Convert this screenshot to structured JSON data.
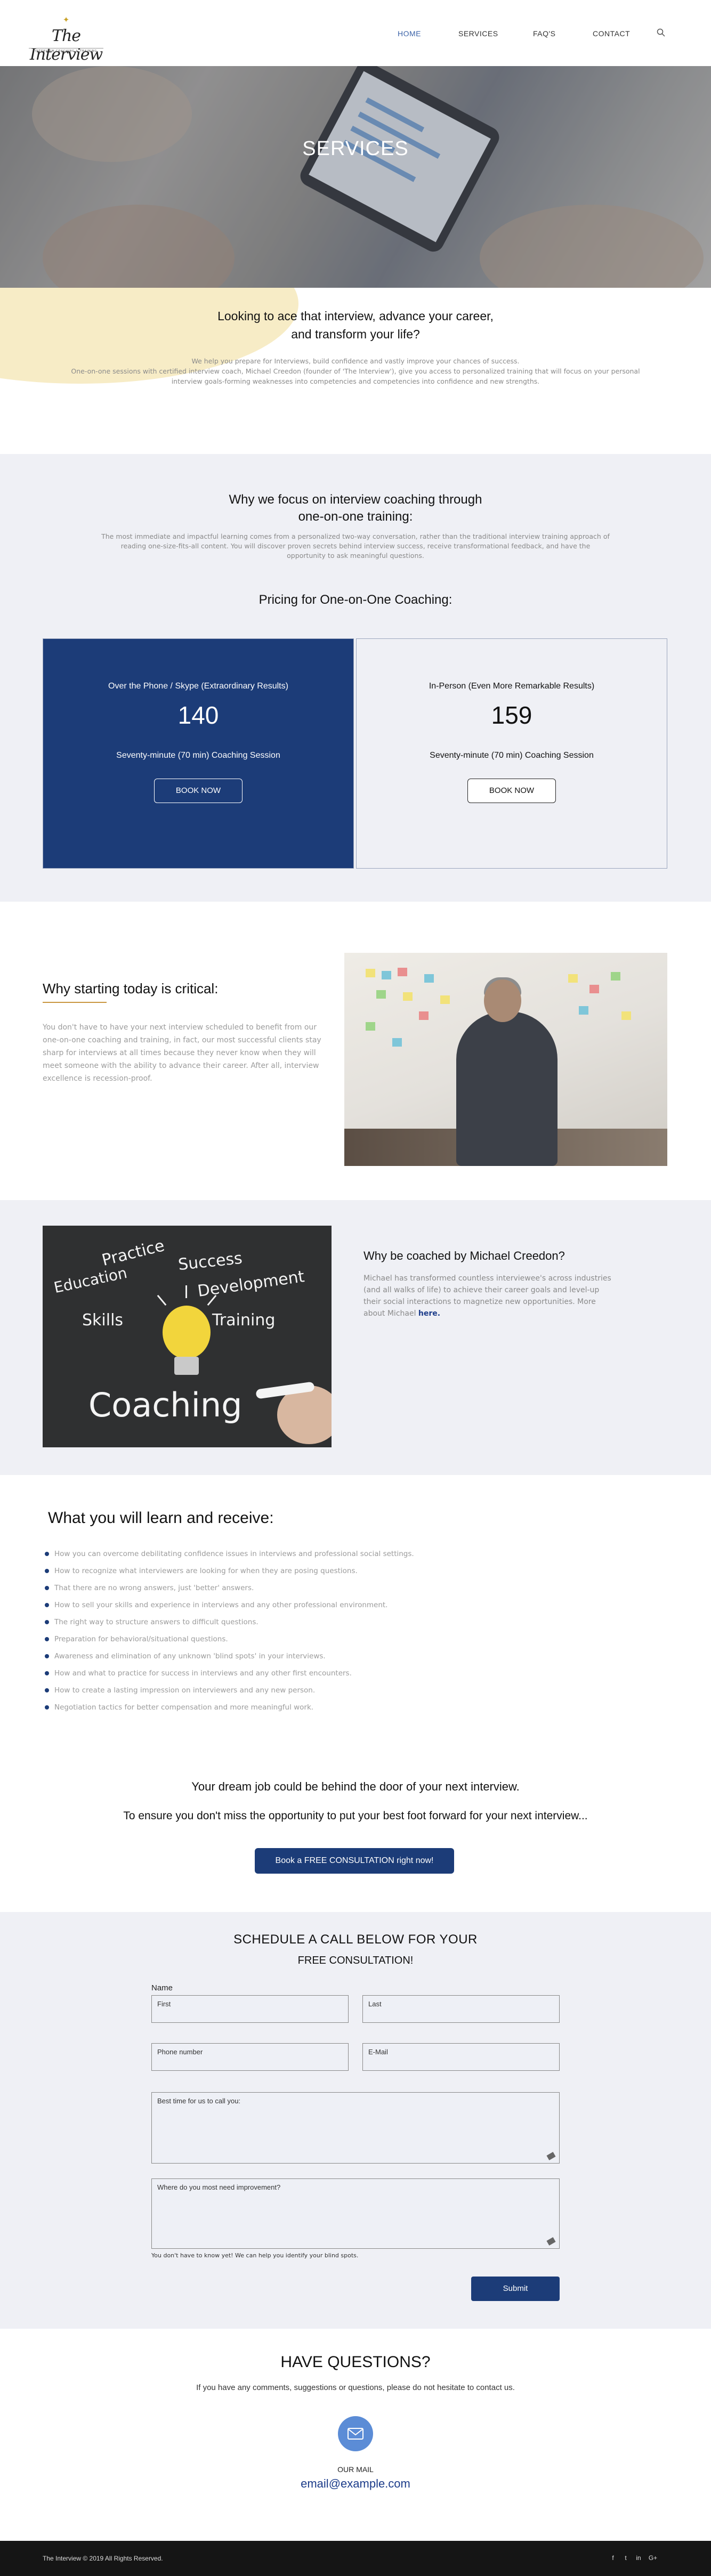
{
  "header": {
    "logo_text": "The Interview",
    "logo_tagline": "INTERVIEW COACHING & TRAINING",
    "nav": [
      {
        "label": "HOME",
        "active": true
      },
      {
        "label": "SERVICES",
        "active": false
      },
      {
        "label": "FAQ'S",
        "active": false
      },
      {
        "label": "CONTACT",
        "active": false
      }
    ],
    "search_icon": "search-icon"
  },
  "hero": {
    "title": "SERVICES"
  },
  "intro": {
    "heading_line1": "Looking to ace that interview, advance your career,",
    "heading_line2": "and transform your life?",
    "body_line1": "We help you prepare for Interviews, build confidence and vastly improve your chances of success.",
    "body_line2": "One-on-one sessions with certified interview coach, Michael Creedon (founder of 'The Interview'), give you access to personalized training that will focus on your personal interview goals-forming weaknesses into competencies and competencies into confidence and new strengths."
  },
  "focus": {
    "heading_line1": "Why we focus on interview coaching through",
    "heading_line2": "one-on-one training:",
    "body": "The most immediate and impactful learning comes from a personalized two-way conversation, rather than the traditional interview training approach of reading one-size-fits-all content. You will discover proven secrets behind interview success, receive transformational feedback, and have the opportunity to ask meaningful questions.",
    "pricing_title": "Pricing for One-on-One Coaching:",
    "cards": [
      {
        "type": "Over the Phone / Skype (Extraordinary Results)",
        "price": "140",
        "duration": "Seventy-minute (70 min) Coaching Session",
        "button": "BOOK NOW"
      },
      {
        "type": "In-Person (Even More Remarkable Results)",
        "price": "159",
        "duration": "Seventy-minute (70 min) Coaching Session",
        "button": "BOOK NOW"
      }
    ]
  },
  "critical": {
    "heading": "Why starting today is critical:",
    "body": "You don't have to have your next interview scheduled to benefit from our one-on-one coaching and training, in fact, our most successful clients stay sharp for interviews at all times because they never know when they will meet someone with the ability to advance their career. After all, interview excellence is recession-proof."
  },
  "coached": {
    "image_words": [
      "Practice",
      "Success",
      "Education",
      "Development",
      "Skills",
      "Training",
      "Coaching"
    ],
    "heading": "Why be coached by Michael Creedon?",
    "body": "Michael has transformed countless interviewee's across industries (and all walks of life) to achieve their career goals and level-up their social interactions to magnetize new opportunities. More about Michael",
    "link": "here."
  },
  "learn": {
    "heading": "What you will learn and receive:",
    "items": [
      "How you can overcome debilitating confidence issues in interviews and professional social settings.",
      "How to recognize what interviewers are looking for when they are posing questions.",
      "That there are no wrong answers, just 'better' answers.",
      "How to sell your skills and experience in interviews and any other professional environment.",
      "The right way to structure answers to difficult questions.",
      "Preparation for behavioral/situational questions.",
      "Awareness and elimination of any unknown 'blind spots' in your interviews.",
      "How and what to practice for success in interviews and any other first encounters.",
      "How to create a lasting impression on interviewers and any new person.",
      "Negotiation tactics for better compensation and more meaningful work."
    ],
    "dream": "Your dream job could be behind the door of your next interview.",
    "ensure": "To ensure you don't miss the opportunity to put your best foot forward for your next interview...",
    "cta": "Book a FREE CONSULTATION right now!"
  },
  "schedule": {
    "heading": "SCHEDULE A CALL BELOW FOR YOUR",
    "subheading": "FREE CONSULTATION!",
    "name_label": "Name",
    "first": "First",
    "last": "Last",
    "phone": "Phone number",
    "email": "E-Mail",
    "best_time": "Best time for us to call you:",
    "improve": "Where do you most need improvement?",
    "hint": "You don't have to know yet! We can help you identify your blind spots.",
    "submit": "Submit"
  },
  "questions": {
    "heading": "HAVE QUESTIONS?",
    "sub": "If you have any comments, suggestions or questions, please do not hesitate to contact us.",
    "our_mail": "OUR MAIL",
    "email": "email@example.com"
  },
  "footer": {
    "copyright": "The Interview © 2019 All Rights Reserved.",
    "social": [
      "f",
      "t",
      "in",
      "G+"
    ]
  },
  "colors": {
    "navy": "#1c3c78",
    "accent_gold": "#c9963f",
    "nav_active": "#3b63a8",
    "section_bg": "#eff0f5"
  }
}
